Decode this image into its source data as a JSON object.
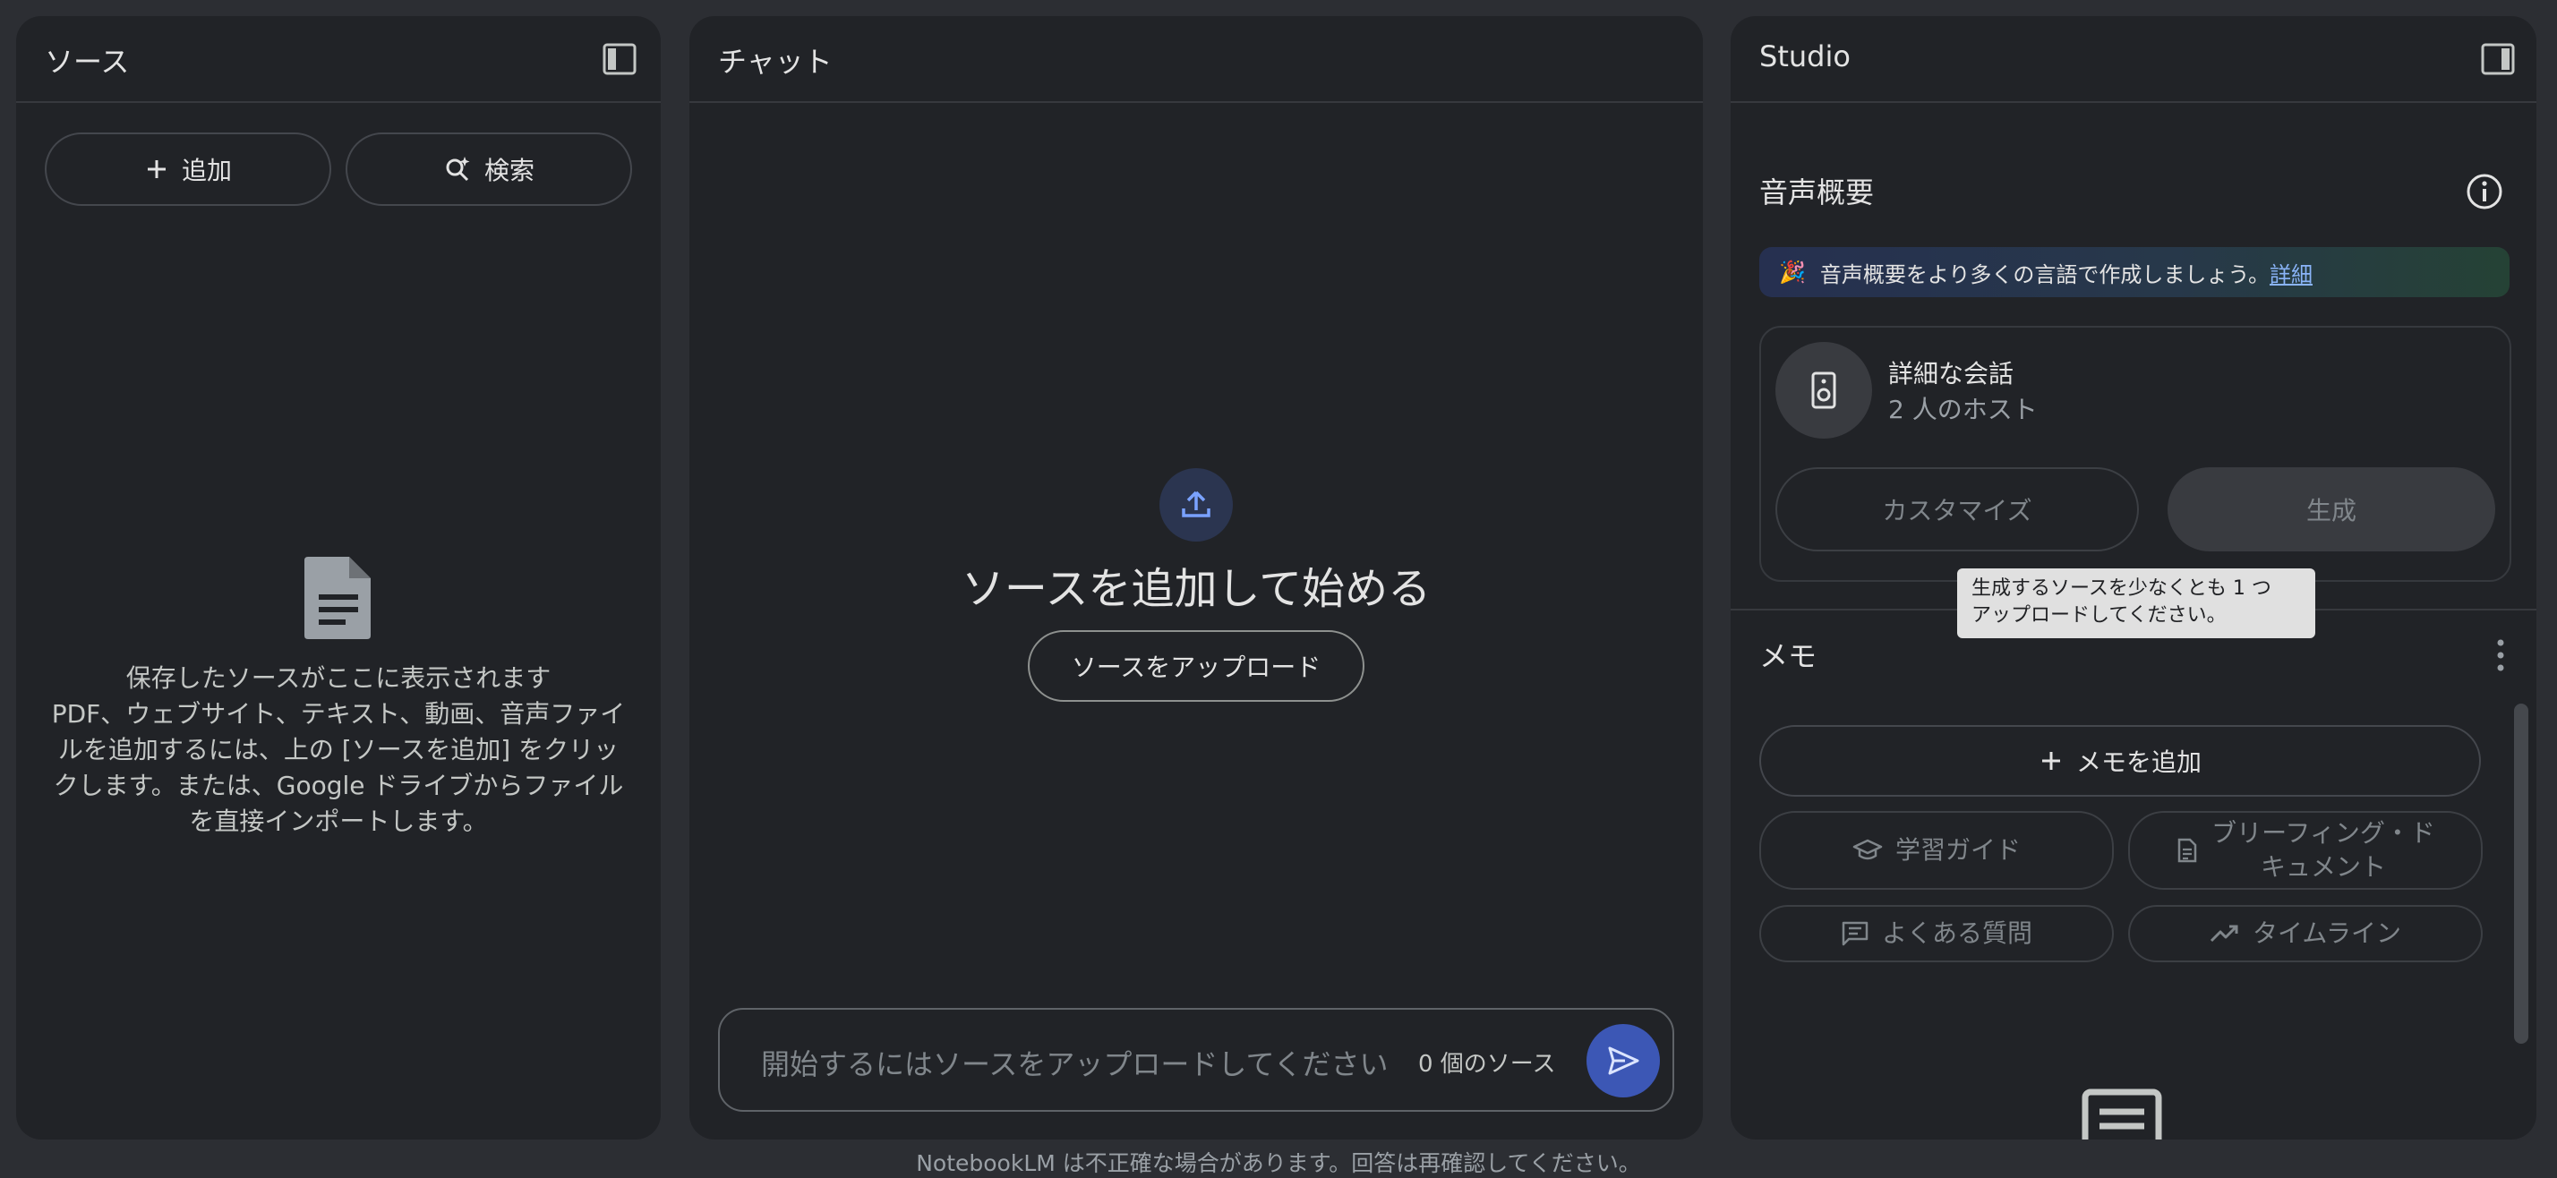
{
  "sources": {
    "title": "ソース",
    "add_label": "追加",
    "search_label": "検索",
    "empty_lines": [
      "保存したソースがここに表示されます",
      "PDF、ウェブサイト、テキスト、動画、音声ファイ",
      "ルを追加するには、上の [ソースを追加] をクリッ",
      "クします。または、Google ドライブからファイル",
      "を直接インポートします。"
    ]
  },
  "chat": {
    "title": "チャット",
    "heading": "ソースを追加して始める",
    "upload_button": "ソースをアップロード",
    "input_placeholder": "開始するにはソースをアップロードしてください",
    "source_count": "0 個のソース"
  },
  "studio": {
    "title": "Studio",
    "audio_title": "音声概要",
    "banner_emoji": "🎉",
    "banner_text": "音声概要をより多くの言語で作成しましょう。",
    "banner_link": "詳細",
    "card_title": "詳細な会話",
    "card_subtitle": "2 人のホスト",
    "customize_label": "カスタマイズ",
    "generate_label": "生成",
    "tooltip_lines": [
      "生成するソースを少なくとも 1 つ",
      "アップロードしてください。"
    ],
    "memo_title": "メモ",
    "add_memo_label": "メモを追加",
    "chips": {
      "study_guide": "学習ガイド",
      "briefing_lines": [
        "ブリーフィング・ド",
        "キュメント"
      ],
      "faq": "よくある質問",
      "timeline": "タイムライン"
    }
  },
  "footer": {
    "disclaimer": "NotebookLM は不正確な場合があります。回答は再確認してください。"
  },
  "colors": {
    "background": "#2c2e33",
    "panel": "#212327",
    "accent_blue": "#3c57b5",
    "link": "#8ab4f8"
  },
  "icons": {
    "panel_toggle": "sidebar-panel-icon",
    "add": "plus-icon",
    "search": "search-sparkle-icon",
    "document": "document-icon",
    "upload": "upload-icon",
    "send": "send-icon",
    "info": "info-icon",
    "speaker": "speaker-icon",
    "more": "more-vert-icon",
    "study": "graduation-cap-icon",
    "briefing": "briefing-doc-icon",
    "faq": "chat-lines-icon",
    "timeline": "trending-icon"
  }
}
